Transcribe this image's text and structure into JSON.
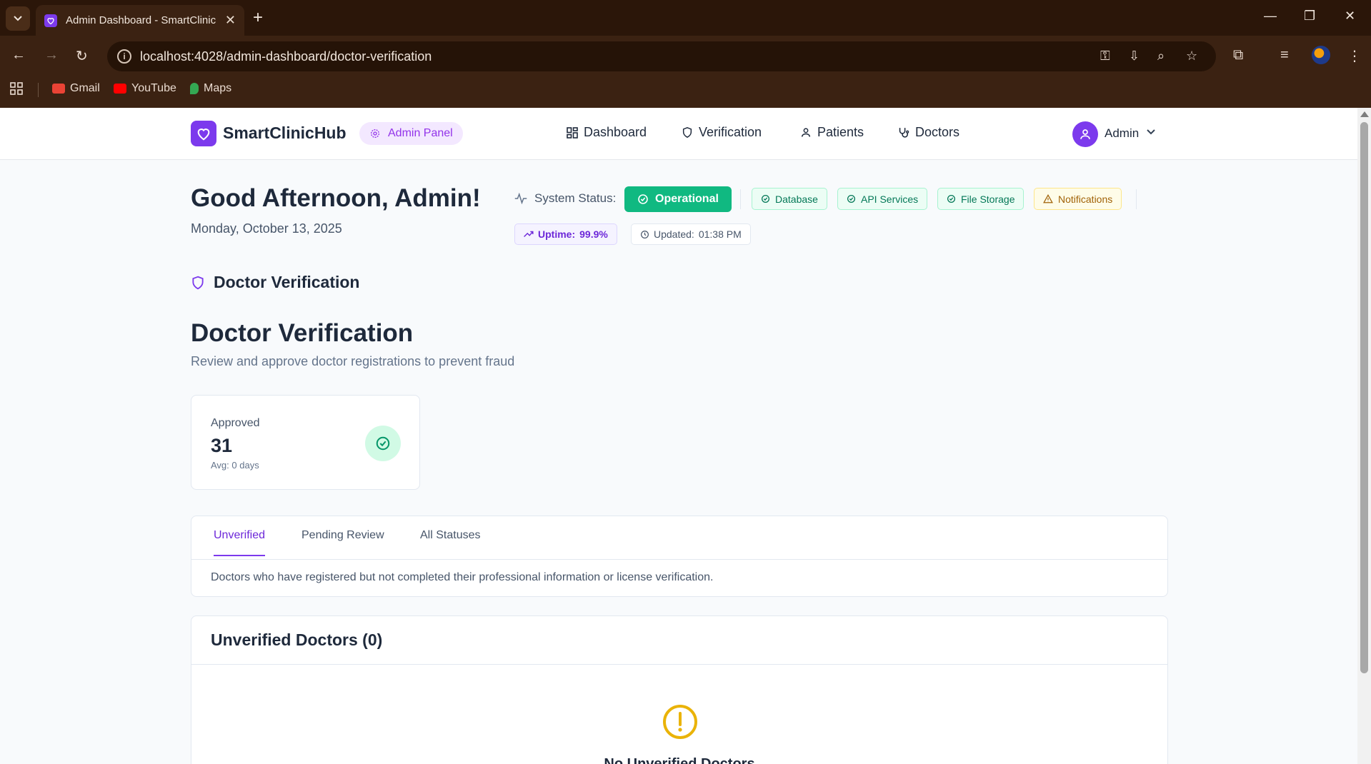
{
  "browser": {
    "tab_title": "Admin Dashboard - SmartClinicHub",
    "url": "localhost:4028/admin-dashboard/doctor-verification",
    "bookmarks": [
      {
        "label": "Gmail",
        "color": "#ea4335"
      },
      {
        "label": "YouTube",
        "color": "#ff0000"
      },
      {
        "label": "Maps",
        "color": "#34a853"
      }
    ]
  },
  "header": {
    "brand": "SmartClinicHub",
    "panel_badge": "Admin Panel",
    "nav": [
      {
        "label": "Dashboard",
        "icon": "grid-icon"
      },
      {
        "label": "Verification",
        "icon": "shield-icon"
      },
      {
        "label": "Patients",
        "icon": "user-icon"
      },
      {
        "label": "Doctors",
        "icon": "stethoscope-icon"
      }
    ],
    "user_label": "Admin"
  },
  "greeting": {
    "title": "Good Afternoon, Admin!",
    "date": "Monday, October 13, 2025"
  },
  "system_status": {
    "label": "System Status:",
    "overall": "Operational",
    "services": [
      {
        "label": "Database",
        "state": "ok"
      },
      {
        "label": "API Services",
        "state": "ok"
      },
      {
        "label": "File Storage",
        "state": "ok"
      },
      {
        "label": "Notifications",
        "state": "warning"
      }
    ],
    "uptime_label": "Uptime:",
    "uptime_value": "99.9%",
    "updated_label": "Updated:",
    "updated_value": "01:38 PM"
  },
  "section": {
    "title": "Doctor Verification"
  },
  "page": {
    "title": "Doctor Verification",
    "subtitle": "Review and approve doctor registrations to prevent fraud"
  },
  "stats": {
    "approved_label": "Approved",
    "approved_value": "31",
    "approved_avg": "Avg: 0 days"
  },
  "tabs": {
    "items": [
      "Unverified",
      "Pending Review",
      "All Statuses"
    ],
    "active": "Unverified",
    "description": "Doctors who have registered but not completed their professional information or license verification."
  },
  "list": {
    "title": "Unverified Doctors (0)",
    "empty_title": "No Unverified Doctors"
  },
  "colors": {
    "accent": "#7c3aed",
    "success": "#10b981",
    "warning": "#eab308"
  }
}
